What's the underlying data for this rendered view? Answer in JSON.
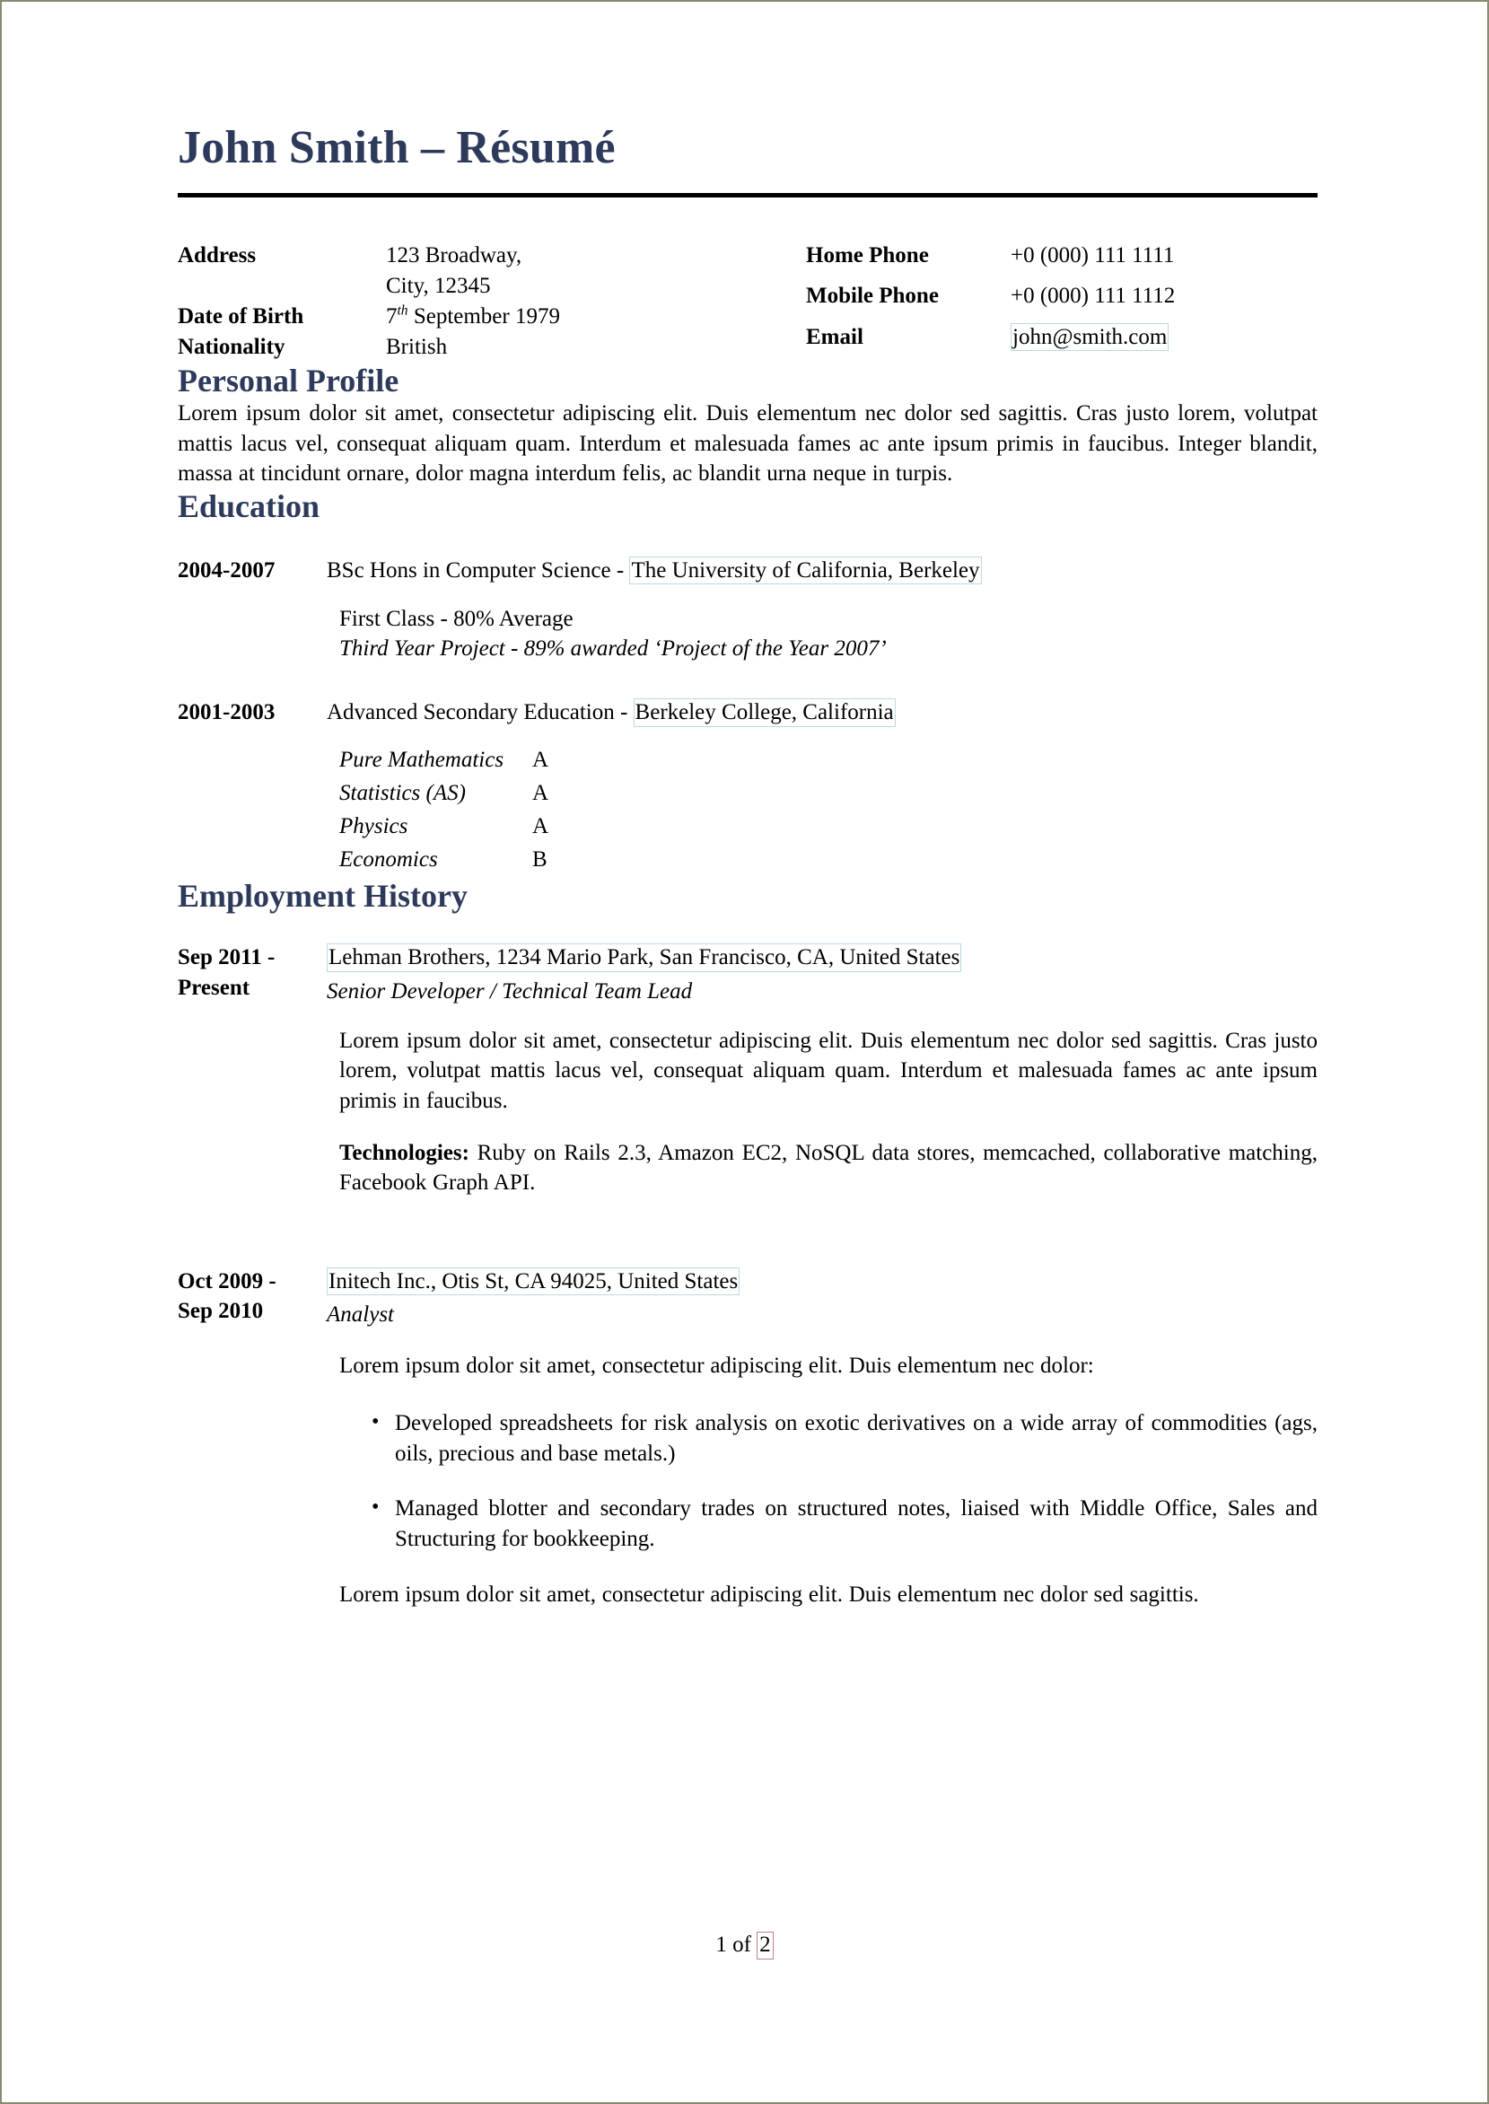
{
  "document": {
    "title": "John Smith – Résumé"
  },
  "contact": {
    "left": [
      {
        "label": "Address",
        "value": "123 Broadway,"
      },
      {
        "label": "",
        "value": "City, 12345"
      },
      {
        "label": "Date of Birth",
        "value_pre": "7",
        "value_ord": "th",
        "value_post": " September 1979"
      },
      {
        "label": "Nationality",
        "value": "British"
      }
    ],
    "left_labels": {
      "address": "Address",
      "dob": "Date of Birth",
      "nationality": "Nationality"
    },
    "left_values": {
      "address_line1": "123 Broadway,",
      "address_line2": "City, 12345",
      "dob_day": "7",
      "dob_ordinal": "th",
      "dob_rest": " September 1979",
      "nationality": "British"
    },
    "right_labels": {
      "home_phone": "Home Phone",
      "mobile_phone": "Mobile Phone",
      "email": "Email"
    },
    "right_values": {
      "home_phone": "+0 (000) 111 1111",
      "mobile_phone": "+0 (000) 111 1112",
      "email": "john@smith.com"
    }
  },
  "sections": {
    "personal_profile": {
      "heading": "Personal Profile",
      "text": "Lorem ipsum dolor sit amet, consectetur adipiscing elit. Duis elementum nec dolor sed sagittis. Cras justo lorem, volutpat mattis lacus vel, consequat aliquam quam. Interdum et malesuada fames ac ante ipsum primis in faucibus. Integer blandit, massa at tincidunt ornare, dolor magna interdum felis, ac blandit urna neque in turpis."
    },
    "education": {
      "heading": "Education",
      "entries": [
        {
          "dates": "2004-2007",
          "title_pre": "BSc Hons in Computer Science - ",
          "institution": "The University of California, Berkeley",
          "detail_1": "First Class - 80% Average",
          "detail_2": "Third Year Project - 89% awarded ‘Project of the Year 2007’"
        },
        {
          "dates": "2001-2003",
          "title_pre": "Advanced Secondary Education - ",
          "institution": "Berkeley College, California",
          "grades": [
            {
              "subject": "Pure Mathematics",
              "grade": "A"
            },
            {
              "subject": "Statistics (AS)",
              "grade": "A"
            },
            {
              "subject": "Physics",
              "grade": "A"
            },
            {
              "subject": "Economics",
              "grade": "B"
            }
          ]
        }
      ]
    },
    "employment": {
      "heading": "Employment History",
      "jobs": [
        {
          "dates_line1": "Sep 2011 -",
          "dates_line2": "Present",
          "employer": "Lehman Brothers, 1234 Mario Park, San Francisco, CA, United States",
          "role": "Senior Developer / Technical Team Lead",
          "description": "Lorem ipsum dolor sit amet, consectetur adipiscing elit. Duis elementum nec dolor sed sagittis. Cras justo lorem, volutpat mattis lacus vel, consequat aliquam quam. Interdum et malesuada fames ac ante ipsum primis in faucibus.",
          "tech_label": "Technologies:",
          "tech_value": " Ruby on Rails 2.3, Amazon EC2, NoSQL data stores, memcached, collaborative matching, Facebook Graph API."
        },
        {
          "dates_line1": "Oct 2009 -",
          "dates_line2": "Sep 2010",
          "employer": "Initech Inc., Otis St, CA 94025, United States",
          "role": "Analyst",
          "intro": "Lorem ipsum dolor sit amet, consectetur adipiscing elit. Duis elementum nec dolor:",
          "bullets": [
            "Developed spreadsheets for risk analysis on exotic derivatives on a wide array of commodities (ags, oils, precious and base metals.)",
            "Managed blotter and secondary trades on structured notes, liaised with Middle Office, Sales and Structuring for bookkeeping."
          ],
          "outro": "Lorem ipsum dolor sit amet, consectetur adipiscing elit. Duis elementum nec dolor sed sagittis."
        }
      ]
    }
  },
  "footer": {
    "page_prefix": "1 of ",
    "page_total": "2"
  },
  "colors": {
    "heading": "#2e3a5c",
    "rule": "#000000",
    "link_box": "#bcd8e2",
    "page_ref_box": "#c08080",
    "page_border": "#8a8a70"
  }
}
